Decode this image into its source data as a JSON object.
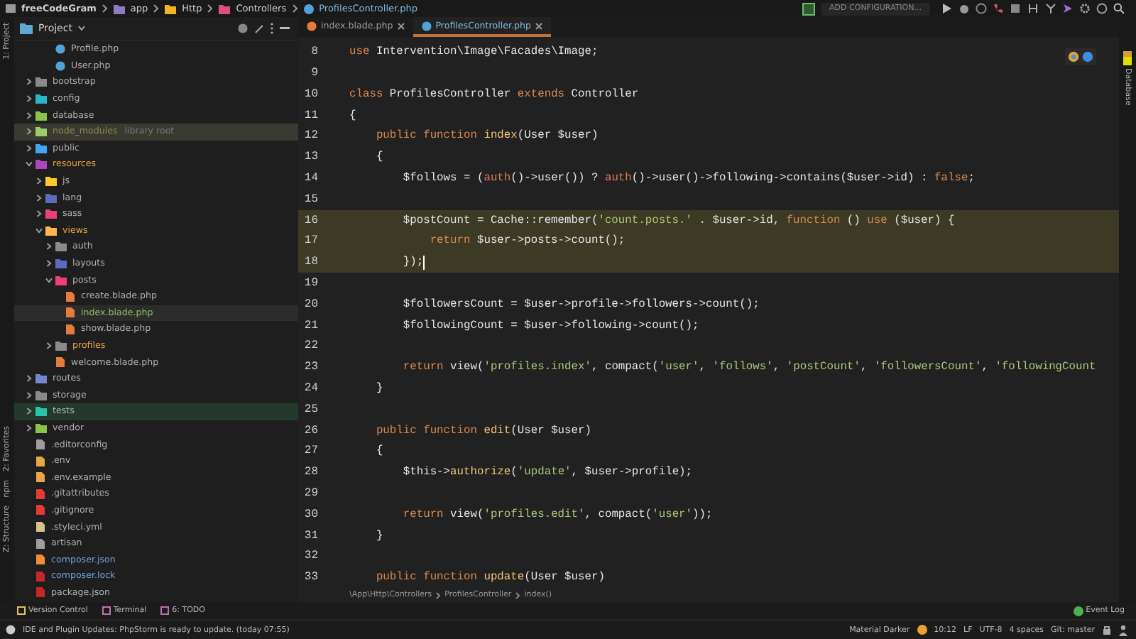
{
  "breadcrumb": [
    "freeCodeGram",
    "app",
    "Http",
    "Controllers",
    "ProfilesController.php"
  ],
  "toolbar": {
    "config_button": "ADD CONFIGURATION..."
  },
  "project_panel": {
    "title": "Project",
    "partial_items": [
      {
        "label": "Profile.php",
        "icon": {
          "color": "#4fa3d8"
        },
        "color": "#aeaeae"
      },
      {
        "label": "User.php",
        "icon": {
          "color": "#4fa3d8"
        },
        "color": "#aeaeae"
      }
    ],
    "items": [
      {
        "kind": "folder",
        "label": "bootstrap",
        "icon": {
          "color": "#8a8a8a"
        },
        "color": "#aeaeae",
        "expanded": false
      },
      {
        "kind": "folder",
        "label": "config",
        "icon": {
          "color": "#29b6c6"
        },
        "color": "#aeaeae",
        "expanded": false
      },
      {
        "kind": "folder",
        "label": "database",
        "icon": {
          "color": "#8bc34a"
        },
        "color": "#aeaeae",
        "expanded": false
      },
      {
        "kind": "excluded_folder",
        "label": "node_modules",
        "suffix": "library root",
        "icon": {
          "color": "#9ccc65"
        },
        "color": "#8a8a55",
        "expanded": false
      },
      {
        "kind": "folder",
        "label": "public",
        "icon": {
          "color": "#42a5f5"
        },
        "color": "#aeaeae",
        "expanded": false
      },
      {
        "kind": "folder",
        "label": "resources",
        "icon": {
          "color": "#ab47bc"
        },
        "color": "#e8a33d",
        "expanded": true,
        "children": [
          {
            "kind": "folder",
            "label": "js",
            "icon": {
              "color": "#ffca28"
            },
            "color": "#aeaeae",
            "expanded": false
          },
          {
            "kind": "folder",
            "label": "lang",
            "icon": {
              "color": "#5c6bc0"
            },
            "color": "#aeaeae",
            "expanded": false
          },
          {
            "kind": "folder",
            "label": "sass",
            "icon": {
              "color": "#ec407a"
            },
            "color": "#aeaeae",
            "expanded": false
          },
          {
            "kind": "folder",
            "label": "views",
            "icon": {
              "color": "#ffb74d"
            },
            "color": "#e8a33d",
            "expanded": true,
            "children": [
              {
                "kind": "folder",
                "label": "auth",
                "icon": {
                  "color": "#8a8a8a"
                },
                "color": "#aeaeae",
                "expanded": false
              },
              {
                "kind": "folder",
                "label": "layouts",
                "icon": {
                  "color": "#5c6bc0"
                },
                "color": "#aeaeae",
                "expanded": false
              },
              {
                "kind": "folder",
                "label": "posts",
                "icon": {
                  "color": "#ec407a"
                },
                "color": "#aeaeae",
                "expanded": true,
                "children": [
                  {
                    "kind": "file",
                    "label": "create.blade.php",
                    "icon": {
                      "color": "#e57c3a"
                    },
                    "color": "#aeaeae",
                    "selected": false
                  },
                  {
                    "kind": "file",
                    "label": "index.blade.php",
                    "icon": {
                      "color": "#e57c3a"
                    },
                    "color": "#8cbf5c",
                    "selected": true
                  },
                  {
                    "kind": "file",
                    "label": "show.blade.php",
                    "icon": {
                      "color": "#e57c3a"
                    },
                    "color": "#aeaeae",
                    "selected": false
                  }
                ]
              },
              {
                "kind": "folder",
                "label": "profiles",
                "icon": {
                  "color": "#8a8a8a"
                },
                "color": "#e8a33d",
                "expanded": false
              },
              {
                "kind": "file",
                "label": "welcome.blade.php",
                "icon": {
                  "color": "#e57c3a"
                },
                "color": "#aeaeae"
              }
            ]
          }
        ]
      },
      {
        "kind": "folder",
        "label": "routes",
        "icon": {
          "color": "#7986cb"
        },
        "color": "#aeaeae",
        "expanded": false
      },
      {
        "kind": "folder",
        "label": "storage",
        "icon": {
          "color": "#8a8a8a"
        },
        "color": "#aeaeae",
        "expanded": false
      },
      {
        "kind": "test_folder",
        "label": "tests",
        "icon": {
          "color": "#26c6a6"
        },
        "color": "#aeaeae",
        "expanded": false
      },
      {
        "kind": "folder",
        "label": "vendor",
        "icon": {
          "color": "#8bc34a"
        },
        "color": "#aeaeae",
        "expanded": false
      },
      {
        "kind": "file",
        "label": ".editorconfig",
        "icon": {
          "color": "#9e9e9e"
        },
        "color": "#aeaeae"
      },
      {
        "kind": "file",
        "label": ".env",
        "icon": {
          "color": "#e5a54b"
        },
        "color": "#aeaeae"
      },
      {
        "kind": "file",
        "label": ".env.example",
        "icon": {
          "color": "#e5a54b"
        },
        "color": "#aeaeae"
      },
      {
        "kind": "file",
        "label": ".gitattributes",
        "icon": {
          "color": "#e53935"
        },
        "color": "#aeaeae"
      },
      {
        "kind": "file",
        "label": ".gitignore",
        "icon": {
          "color": "#e53935"
        },
        "color": "#aeaeae"
      },
      {
        "kind": "file",
        "label": ".styleci.yml",
        "icon": {
          "color": "#d4c38a"
        },
        "color": "#aeaeae"
      },
      {
        "kind": "file",
        "label": "artisan",
        "icon": {
          "color": "#9e9e9e"
        },
        "color": "#aeaeae"
      },
      {
        "kind": "file",
        "label": "composer.json",
        "icon": {
          "color": "#f08c3a"
        },
        "color": "#6f9fd8"
      },
      {
        "kind": "file",
        "label": "composer.lock",
        "icon": {
          "color": "#c62828"
        },
        "color": "#6f9fd8"
      },
      {
        "kind": "file",
        "label": "package.json",
        "icon": {
          "color": "#c62828"
        },
        "color": "#aeaeae"
      }
    ]
  },
  "tabs": [
    {
      "label": "index.blade.php",
      "selected": false,
      "color": "#e57c3a"
    },
    {
      "label": "ProfilesController.php",
      "selected": true,
      "color": "#4fa3d8"
    }
  ],
  "left_tools": [
    "1: Project",
    "2: Favorites",
    "npm",
    "Z: Structure"
  ],
  "right_tools": [
    "Database"
  ],
  "editor": {
    "lines": [
      {
        "number": "8",
        "highlighted": false,
        "tokens": [
          {
            "kind": "keyword",
            "text": "use"
          },
          {
            "kind": "plain",
            "text": " Intervention\\Image\\Facades\\Image;"
          }
        ]
      },
      {
        "number": "9",
        "highlighted": false
      },
      {
        "number": "10",
        "highlighted": false,
        "tokens": [
          {
            "kind": "keyword",
            "text": "class"
          },
          {
            "kind": "plain",
            "text": " ProfilesController "
          },
          {
            "kind": "keyword",
            "text": "extends"
          },
          {
            "kind": "plain",
            "text": " Controller"
          }
        ]
      },
      {
        "number": "11",
        "highlighted": false,
        "tokens": [
          {
            "kind": "plain",
            "text": "{"
          }
        ]
      },
      {
        "number": "12",
        "highlighted": false,
        "tokens": [
          {
            "kind": "keyword",
            "text": "    public function "
          },
          {
            "kind": "function",
            "text": "index"
          },
          {
            "kind": "plain",
            "text": "(User $user)"
          }
        ]
      },
      {
        "number": "13",
        "highlighted": false,
        "tokens": [
          {
            "kind": "plain",
            "text": "    {"
          }
        ]
      },
      {
        "number": "14",
        "highlighted": false,
        "tokens": [
          {
            "kind": "plain",
            "text": "        $follows = ("
          },
          {
            "kind": "call",
            "text": "auth"
          },
          {
            "kind": "plain",
            "text": "()->user()) ? "
          },
          {
            "kind": "call",
            "text": "auth"
          },
          {
            "kind": "plain",
            "text": "()->user()->following->contains($user->id) : "
          },
          {
            "kind": "keyword",
            "text": "false"
          },
          {
            "kind": "plain",
            "text": ";"
          }
        ]
      },
      {
        "number": "15",
        "highlighted": false
      },
      {
        "number": "16",
        "highlighted": true,
        "tokens": [
          {
            "kind": "plain",
            "text": "        $postCount = Cache::remember("
          },
          {
            "kind": "string",
            "text": "'count.posts.'"
          },
          {
            "kind": "plain",
            "text": " . $user->id, "
          },
          {
            "kind": "keyword",
            "text": "function"
          },
          {
            "kind": "plain",
            "text": " () "
          },
          {
            "kind": "keyword",
            "text": "use"
          },
          {
            "kind": "plain",
            "text": " ($user) {"
          }
        ]
      },
      {
        "number": "17",
        "highlighted": true,
        "tokens": [
          {
            "kind": "keyword",
            "text": "            return"
          },
          {
            "kind": "plain",
            "text": " $user->posts->count();"
          }
        ]
      },
      {
        "number": "18",
        "highlighted": true,
        "caret": true,
        "tokens": [
          {
            "kind": "plain",
            "text": "        });"
          }
        ]
      },
      {
        "number": "19",
        "highlighted": false
      },
      {
        "number": "20",
        "highlighted": false,
        "tokens": [
          {
            "kind": "plain",
            "text": "        $followersCount = $user->profile->followers->count();"
          }
        ]
      },
      {
        "number": "21",
        "highlighted": false,
        "tokens": [
          {
            "kind": "plain",
            "text": "        $followingCount = $user->following->count();"
          }
        ]
      },
      {
        "number": "22",
        "highlighted": false
      },
      {
        "number": "23",
        "highlighted": false,
        "tokens": [
          {
            "kind": "keyword",
            "text": "        return"
          },
          {
            "kind": "plain",
            "text": " view("
          },
          {
            "kind": "string",
            "text": "'profiles.index'"
          },
          {
            "kind": "plain",
            "text": ", compact("
          },
          {
            "kind": "string",
            "text": "'user'"
          },
          {
            "kind": "plain",
            "text": ", "
          },
          {
            "kind": "string",
            "text": "'follows'"
          },
          {
            "kind": "plain",
            "text": ", "
          },
          {
            "kind": "string",
            "text": "'postCount'"
          },
          {
            "kind": "plain",
            "text": ", "
          },
          {
            "kind": "string",
            "text": "'followersCount'"
          },
          {
            "kind": "plain",
            "text": ", "
          },
          {
            "kind": "string",
            "text": "'followingCount"
          }
        ]
      },
      {
        "number": "24",
        "highlighted": false,
        "tokens": [
          {
            "kind": "plain",
            "text": "    }"
          }
        ]
      },
      {
        "number": "25",
        "highlighted": false
      },
      {
        "number": "26",
        "highlighted": false,
        "tokens": [
          {
            "kind": "keyword",
            "text": "    public function "
          },
          {
            "kind": "function",
            "text": "edit"
          },
          {
            "kind": "plain",
            "text": "(User $user)"
          }
        ]
      },
      {
        "number": "27",
        "highlighted": false,
        "tokens": [
          {
            "kind": "plain",
            "text": "    {"
          }
        ]
      },
      {
        "number": "28",
        "highlighted": false,
        "tokens": [
          {
            "kind": "plain",
            "text": "        $this->"
          },
          {
            "kind": "function",
            "text": "authorize"
          },
          {
            "kind": "plain",
            "text": "("
          },
          {
            "kind": "string",
            "text": "'update'"
          },
          {
            "kind": "plain",
            "text": ", $user->profile);"
          }
        ]
      },
      {
        "number": "29",
        "highlighted": false
      },
      {
        "number": "30",
        "highlighted": false,
        "tokens": [
          {
            "kind": "keyword",
            "text": "        return"
          },
          {
            "kind": "plain",
            "text": " view("
          },
          {
            "kind": "string",
            "text": "'profiles.edit'"
          },
          {
            "kind": "plain",
            "text": ", compact("
          },
          {
            "kind": "string",
            "text": "'user'"
          },
          {
            "kind": "plain",
            "text": "));"
          }
        ]
      },
      {
        "number": "31",
        "highlighted": false,
        "tokens": [
          {
            "kind": "plain",
            "text": "    }"
          }
        ]
      },
      {
        "number": "32",
        "highlighted": false
      },
      {
        "number": "33",
        "highlighted": false,
        "tokens": [
          {
            "kind": "keyword",
            "text": "    public function "
          },
          {
            "kind": "function",
            "text": "update"
          },
          {
            "kind": "plain",
            "text": "(User $user)"
          }
        ]
      }
    ],
    "path": [
      "\\App\\Http\\Controllers",
      "ProfilesController",
      "index()"
    ]
  },
  "tool_windows": [
    "Version Control",
    "Terminal",
    "6: TODO"
  ],
  "event_log": "Event Log",
  "status_bar": {
    "message": "IDE and Plugin Updates: PhpStorm is ready to update. (today 07:55)",
    "items": [
      "Material Darker",
      "10:12",
      "LF",
      "UTF-8",
      "4 spaces",
      "Git: master"
    ]
  }
}
